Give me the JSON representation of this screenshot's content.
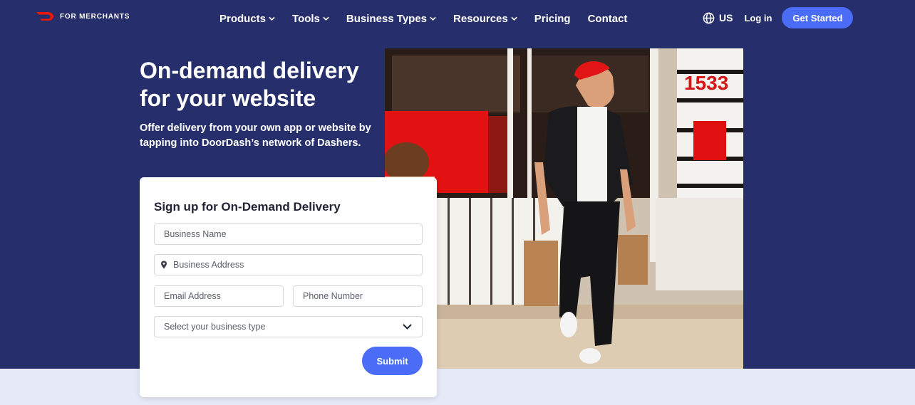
{
  "header": {
    "logo_text": "FOR MERCHANTS",
    "nav": [
      {
        "label": "Products",
        "has_menu": true
      },
      {
        "label": "Tools",
        "has_menu": true
      },
      {
        "label": "Business Types",
        "has_menu": true
      },
      {
        "label": "Resources",
        "has_menu": true
      },
      {
        "label": "Pricing",
        "has_menu": false
      },
      {
        "label": "Contact",
        "has_menu": false
      }
    ],
    "region": "US",
    "login": "Log in",
    "get_started": "Get Started"
  },
  "hero": {
    "headline": "On-demand delivery for your website",
    "subhead": "Offer delivery from your own app or website by tapping into DoorDash’s network of Dashers."
  },
  "form": {
    "title": "Sign up for On-Demand Delivery",
    "business_name_placeholder": "Business Name",
    "business_address_placeholder": "Business Address",
    "email_placeholder": "Email Address",
    "phone_placeholder": "Phone Number",
    "business_type_placeholder": "Select your business type",
    "submit": "Submit"
  },
  "colors": {
    "hero_bg": "#262f6b",
    "accent": "#4a6cf7",
    "brand_red": "#eb1700",
    "band_bg": "#e6eaf7"
  },
  "icons": {
    "logo": "doordash-logo-icon",
    "globe": "globe-icon",
    "chevron": "chevron-down-icon",
    "pin": "location-pin-icon"
  },
  "photo": {
    "storefront_number": "1533"
  }
}
